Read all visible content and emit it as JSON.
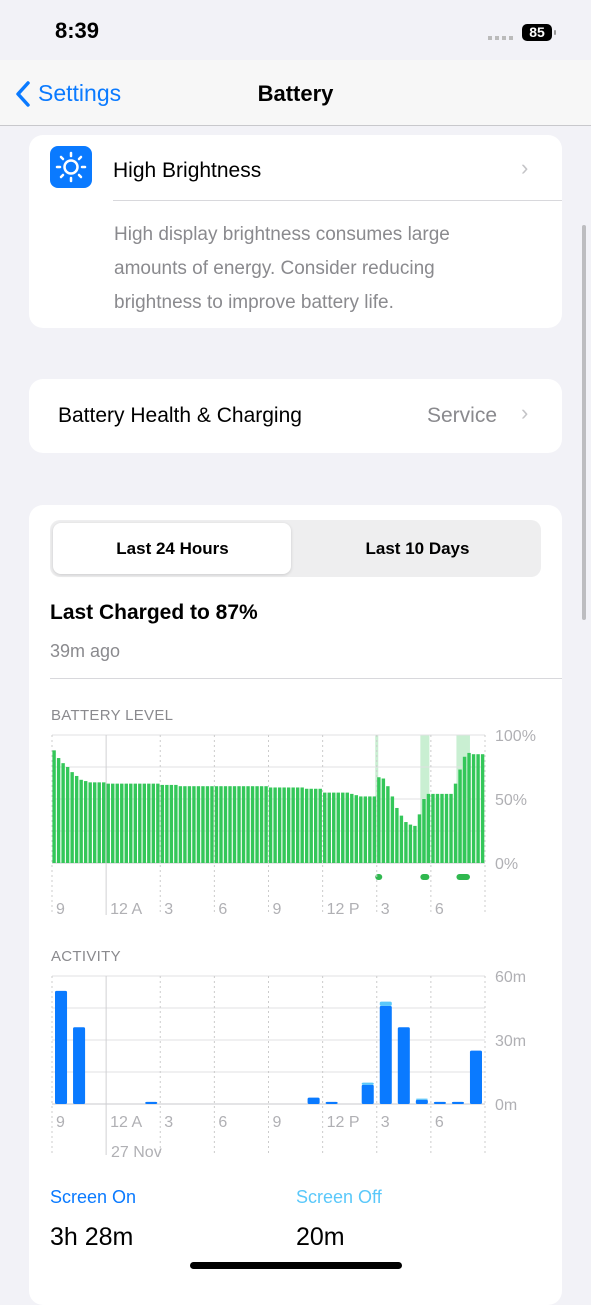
{
  "status_bar": {
    "time": "8:39",
    "battery": "85"
  },
  "nav": {
    "back_label": "Settings",
    "title": "Battery"
  },
  "insight": {
    "icon": "sun-brightness-icon",
    "title": "High Brightness",
    "description_lines": [
      "High display brightness consumes large",
      "amounts of energy. Consider reducing",
      "brightness to improve battery life."
    ]
  },
  "health": {
    "label": "Battery Health & Charging",
    "value": "Service"
  },
  "segmented": {
    "options": [
      "Last 24 Hours",
      "Last 10 Days"
    ],
    "selected": 0
  },
  "last_charged": {
    "title": "Last Charged to 87%",
    "ago": "39m ago"
  },
  "colors": {
    "accent": "#0a7aff",
    "battery_bar": "#34c759",
    "charging_band": "#c9efd2",
    "screen_on": "#0a7aff",
    "screen_off": "#5ac8fa"
  },
  "chart_data": [
    {
      "type": "bar",
      "title": "BATTERY LEVEL",
      "x_tick_labels": [
        "9",
        "12 A",
        "3",
        "6",
        "9",
        "12 P",
        "3",
        "6"
      ],
      "y_tick_labels": [
        "100%",
        "50%",
        "0%"
      ],
      "ylim": [
        0,
        100
      ],
      "interval": "15 min",
      "start": "9 PM",
      "grid": true,
      "values": [
        88,
        82,
        78,
        75,
        71,
        68,
        65,
        64,
        63,
        63,
        63,
        63,
        62,
        62,
        62,
        62,
        62,
        62,
        62,
        62,
        62,
        62,
        62,
        62,
        61,
        61,
        61,
        61,
        60,
        60,
        60,
        60,
        60,
        60,
        60,
        60,
        60,
        60,
        60,
        60,
        60,
        60,
        60,
        60,
        60,
        60,
        60,
        60,
        59,
        59,
        59,
        59,
        59,
        59,
        59,
        59,
        58,
        58,
        58,
        58,
        55,
        55,
        55,
        55,
        55,
        55,
        54,
        53,
        52,
        52,
        52,
        52,
        67,
        66,
        60,
        52,
        43,
        37,
        32,
        30,
        29,
        38,
        50,
        54,
        54,
        54,
        54,
        54,
        54,
        62,
        73,
        83,
        86,
        85,
        85,
        85
      ],
      "charging_periods": [
        [
          "2:55 PM",
          "3:05 PM"
        ],
        [
          "5:25 PM",
          "5:55 PM"
        ],
        [
          "7:25 PM",
          "8:10 PM"
        ]
      ]
    },
    {
      "type": "bar",
      "title": "ACTIVITY",
      "x_tick_labels": [
        "9",
        "12 A",
        "3",
        "6",
        "9",
        "12 P",
        "3",
        "6"
      ],
      "date_label": "27 Nov",
      "y_tick_labels": [
        "60m",
        "30m",
        "0m"
      ],
      "ylim": [
        0,
        60
      ],
      "interval": "1 hour",
      "start": "9 PM",
      "grid": true,
      "series": [
        {
          "name": "Screen On",
          "values": [
            53,
            36,
            0,
            0,
            0,
            1,
            0,
            0,
            0,
            0,
            0,
            0,
            0,
            0,
            3,
            1,
            0,
            9,
            46,
            36,
            2,
            1,
            1,
            25
          ]
        },
        {
          "name": "Screen Off",
          "values": [
            0,
            0,
            0,
            0,
            0,
            0,
            0,
            0,
            0,
            0,
            0,
            0,
            0,
            0,
            0,
            0,
            0,
            1,
            2,
            0,
            0.5,
            0,
            0,
            0
          ]
        }
      ]
    }
  ],
  "usage": {
    "screen_on_label": "Screen On",
    "screen_on_value": "3h 28m",
    "screen_off_label": "Screen Off",
    "screen_off_value": "20m"
  }
}
